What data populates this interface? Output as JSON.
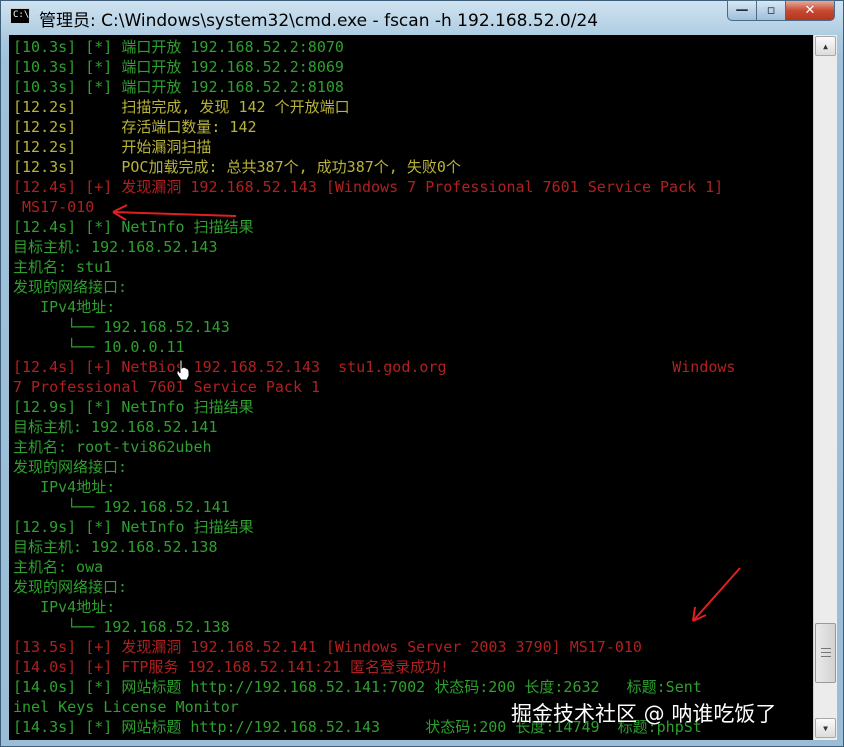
{
  "window": {
    "title": "管理员: C:\\Windows\\system32\\cmd.exe - fscan  -h 192.168.52.0/24",
    "icon_text": "C:\\",
    "controls": {
      "minimize": "—",
      "maximize": "▫",
      "close": "✕"
    }
  },
  "colors": {
    "green": "#2ea02e",
    "yellow": "#b8b33a",
    "red": "#b02020",
    "background": "#000000",
    "arrow": "#e02020"
  },
  "console": {
    "lines": [
      {
        "color": "g",
        "text": "[10.3s] [*] 端口开放 192.168.52.2:8070"
      },
      {
        "color": "g",
        "text": "[10.3s] [*] 端口开放 192.168.52.2:8069"
      },
      {
        "color": "g",
        "text": "[10.3s] [*] 端口开放 192.168.52.2:8108"
      },
      {
        "color": "y",
        "text": "[12.2s]     扫描完成, 发现 142 个开放端口"
      },
      {
        "color": "y",
        "text": "[12.2s]     存活端口数量: 142"
      },
      {
        "color": "y",
        "text": "[12.2s]     开始漏洞扫描"
      },
      {
        "color": "y",
        "text": "[12.3s]     POC加载完成: 总共387个, 成功387个, 失败0个"
      },
      {
        "color": "r",
        "text": "[12.4s] [+] 发现漏洞 192.168.52.143 [Windows 7 Professional 7601 Service Pack 1]"
      },
      {
        "color": "r",
        "text": " MS17-010"
      },
      {
        "color": "g",
        "text": "[12.4s] [*] NetInfo 扫描结果"
      },
      {
        "color": "g",
        "text": "目标主机: 192.168.52.143"
      },
      {
        "color": "g",
        "text": "主机名: stu1"
      },
      {
        "color": "g",
        "text": "发现的网络接口:"
      },
      {
        "color": "g",
        "text": "   IPv4地址:"
      },
      {
        "color": "g",
        "text": "      └── 192.168.52.143"
      },
      {
        "color": "g",
        "text": "      └── 10.0.0.11"
      },
      {
        "color": "r",
        "text": "[12.4s] [+] NetBios 192.168.52.143  stu1.god.org                         Windows"
      },
      {
        "color": "r",
        "text": "7 Professional 7601 Service Pack 1"
      },
      {
        "color": "g",
        "text": "[12.9s] [*] NetInfo 扫描结果"
      },
      {
        "color": "g",
        "text": "目标主机: 192.168.52.141"
      },
      {
        "color": "g",
        "text": "主机名: root-tvi862ubeh"
      },
      {
        "color": "g",
        "text": "发现的网络接口:"
      },
      {
        "color": "g",
        "text": "   IPv4地址:"
      },
      {
        "color": "g",
        "text": "      └── 192.168.52.141"
      },
      {
        "color": "g",
        "text": "[12.9s] [*] NetInfo 扫描结果"
      },
      {
        "color": "g",
        "text": "目标主机: 192.168.52.138"
      },
      {
        "color": "g",
        "text": "主机名: owa"
      },
      {
        "color": "g",
        "text": "发现的网络接口:"
      },
      {
        "color": "g",
        "text": "   IPv4地址:"
      },
      {
        "color": "g",
        "text": "      └── 192.168.52.138"
      },
      {
        "color": "r",
        "text": "[13.5s] [+] 发现漏洞 192.168.52.141 [Windows Server 2003 3790] MS17-010"
      },
      {
        "color": "r",
        "text": "[14.0s] [+] FTP服务 192.168.52.141:21 匿名登录成功!"
      },
      {
        "color": "g",
        "text": "[14.0s] [*] 网站标题 http://192.168.52.141:7002 状态码:200 长度:2632   标题:Sent"
      },
      {
        "color": "g",
        "text": "inel Keys License Monitor"
      },
      {
        "color": "g",
        "text": "[14.3s] [*] 网站标题 http://192.168.52.143     状态码:200 长度:14749  标题:phpSt"
      }
    ]
  },
  "watermark": "掘金技术社区 @ 呐谁吃饭了"
}
